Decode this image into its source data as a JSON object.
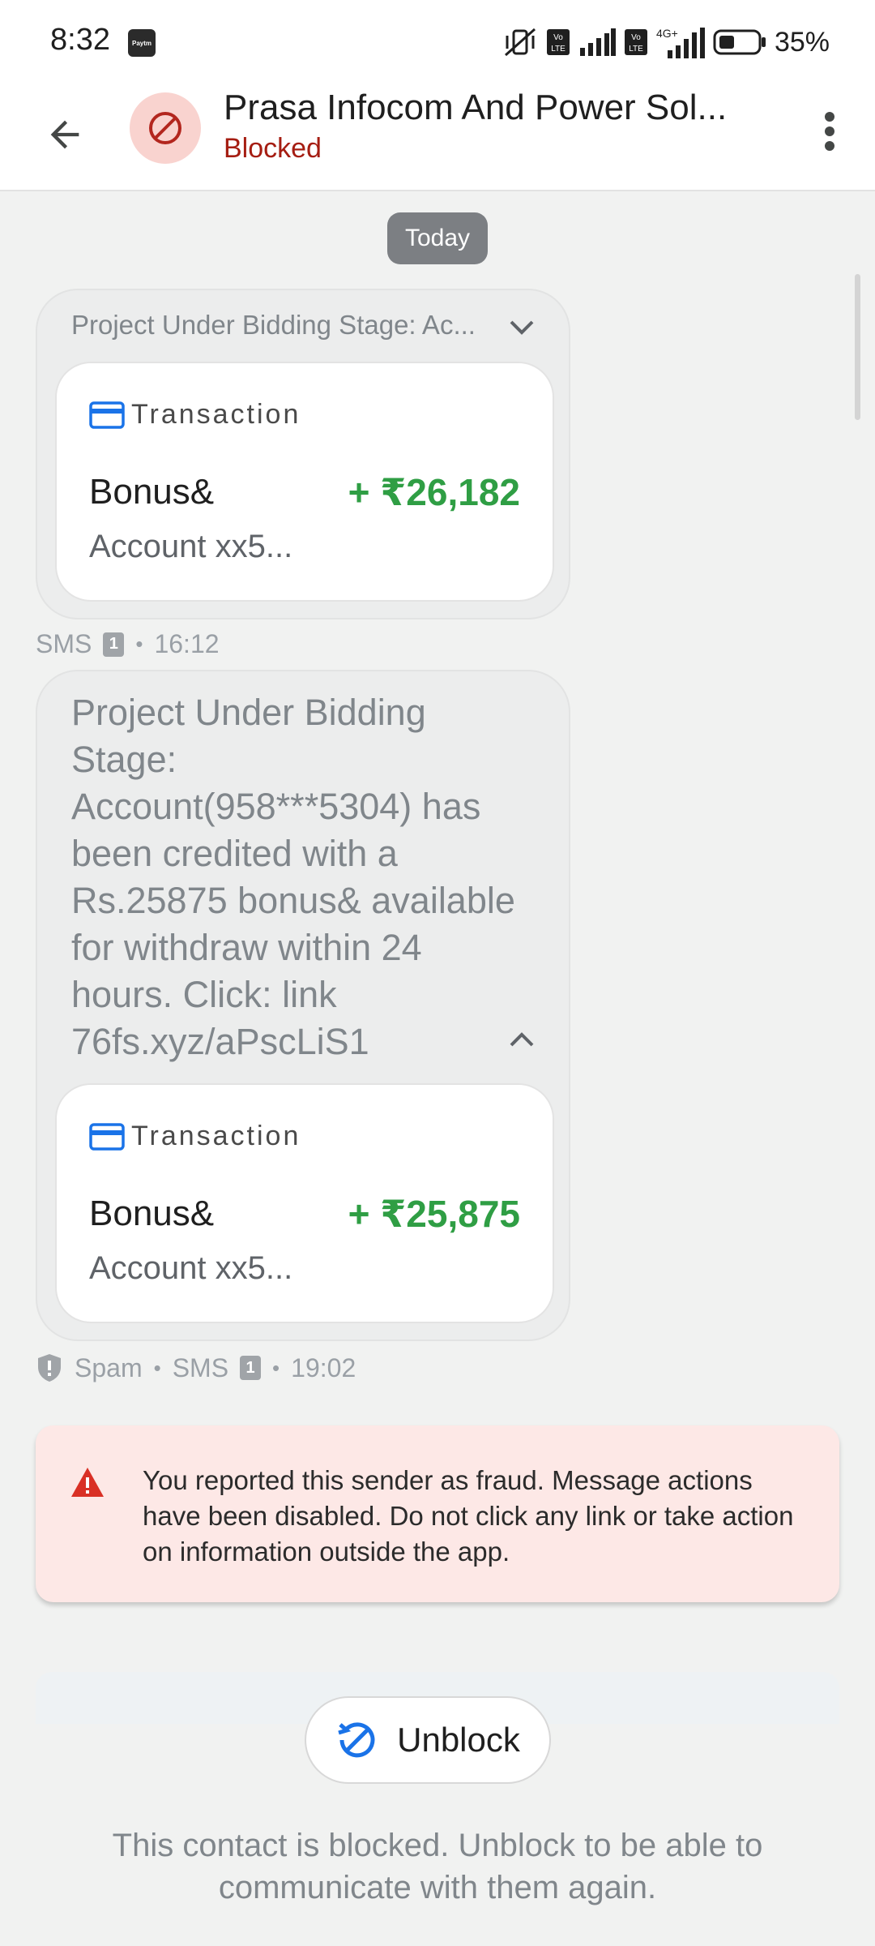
{
  "status_bar": {
    "time": "8:32",
    "paytm_label": "Paytm",
    "battery": "35%"
  },
  "header": {
    "back_icon": "arrow-back-icon",
    "avatar_icon": "block-icon",
    "contact_name": "Prasa Infocom And Power Sol...",
    "contact_status": "Blocked",
    "more_icon": "more-vert-icon"
  },
  "date_chip": "Today",
  "messages": [
    {
      "preview": "Project Under Bidding Stage: Ac...",
      "card": {
        "label": "Transaction",
        "title": "Bonus&",
        "amount": "+ ₹26,182",
        "subtitle": "Account xx5..."
      },
      "meta": {
        "channel": "SMS",
        "sim": "1",
        "time": "16:12"
      }
    },
    {
      "body": "Project Under Bidding Stage: Account(958***5304) has been credited with a Rs.25875 bonus& available for withdraw within 24 hours. Click: link 76fs.xyz/aPscLiS1",
      "card": {
        "label": "Transaction",
        "title": "Bonus&",
        "amount": "+ ₹25,875",
        "subtitle": "Account xx5..."
      },
      "meta": {
        "spam": "Spam",
        "channel": "SMS",
        "sim": "1",
        "time": "19:02"
      }
    }
  ],
  "fraud_banner": {
    "icon": "warning-icon",
    "text": "You reported this sender as fraud. Message actions have been disabled. Do not click any link or take action on information outside the app."
  },
  "unblock": {
    "label": "Unblock",
    "icon": "unblock-icon"
  },
  "blocked_note": "This contact is blocked. Unblock to be able to communicate with them again.",
  "colors": {
    "blocked_red": "#a51d12",
    "amount_green": "#2f9e44",
    "card_blue": "#1a73e8",
    "banner_bg": "#fde8e6",
    "warning_red": "#d93025"
  }
}
